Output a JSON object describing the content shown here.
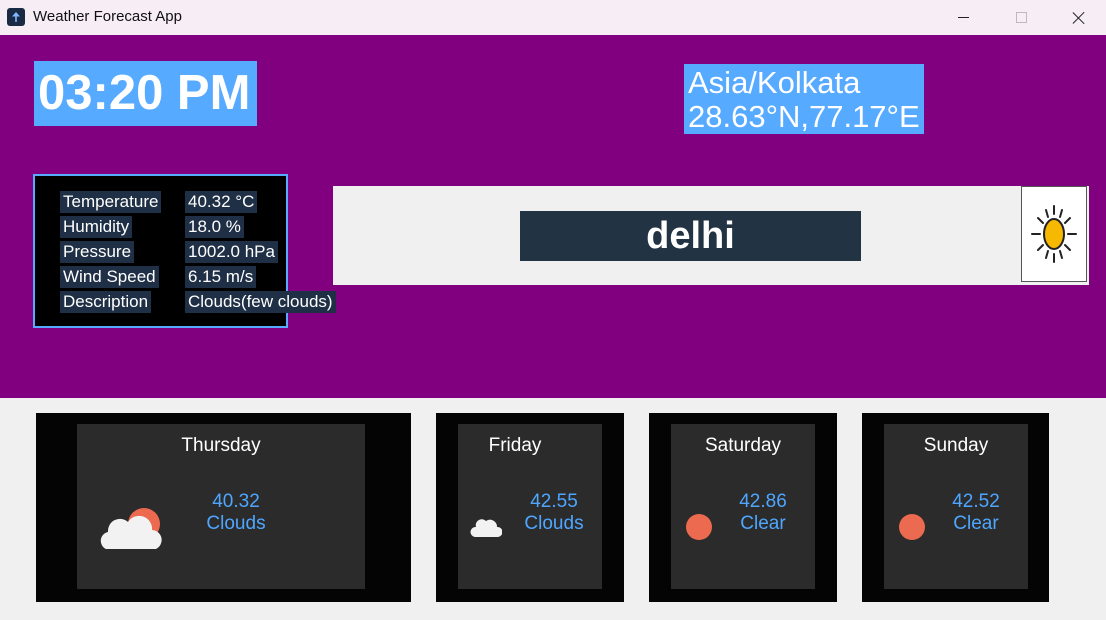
{
  "window": {
    "title": "Weather Forecast App"
  },
  "clock": {
    "time": "03:20 PM"
  },
  "location": {
    "timezone": "Asia/Kolkata",
    "coords": "28.63°N,77.17°E"
  },
  "current": [
    {
      "label": "Temperature",
      "value": "40.32 °C"
    },
    {
      "label": "Humidity",
      "value": "18.0 %"
    },
    {
      "label": "Pressure",
      "value": "1002.0 hPa"
    },
    {
      "label": "Wind Speed",
      "value": "6.15 m/s"
    },
    {
      "label": "Description",
      "value": "Clouds(few clouds)"
    }
  ],
  "search": {
    "city": "delhi",
    "icon": "sun-icon"
  },
  "forecast": [
    {
      "day": "Thursday",
      "temp": "40.32",
      "desc": "Clouds",
      "icon": "cloud-sun-icon"
    },
    {
      "day": "Friday",
      "temp": "42.55",
      "desc": "Clouds",
      "icon": "cloud-icon"
    },
    {
      "day": "Saturday",
      "temp": "42.86",
      "desc": "Clear",
      "icon": "sun-icon"
    },
    {
      "day": "Sunday",
      "temp": "42.52",
      "desc": "Clear",
      "icon": "sun-icon"
    }
  ],
  "colors": {
    "header_bg": "#800080",
    "highlight": "#56aaff",
    "temp_text": "#4ea6ff",
    "sun": "#ec6a4f"
  }
}
